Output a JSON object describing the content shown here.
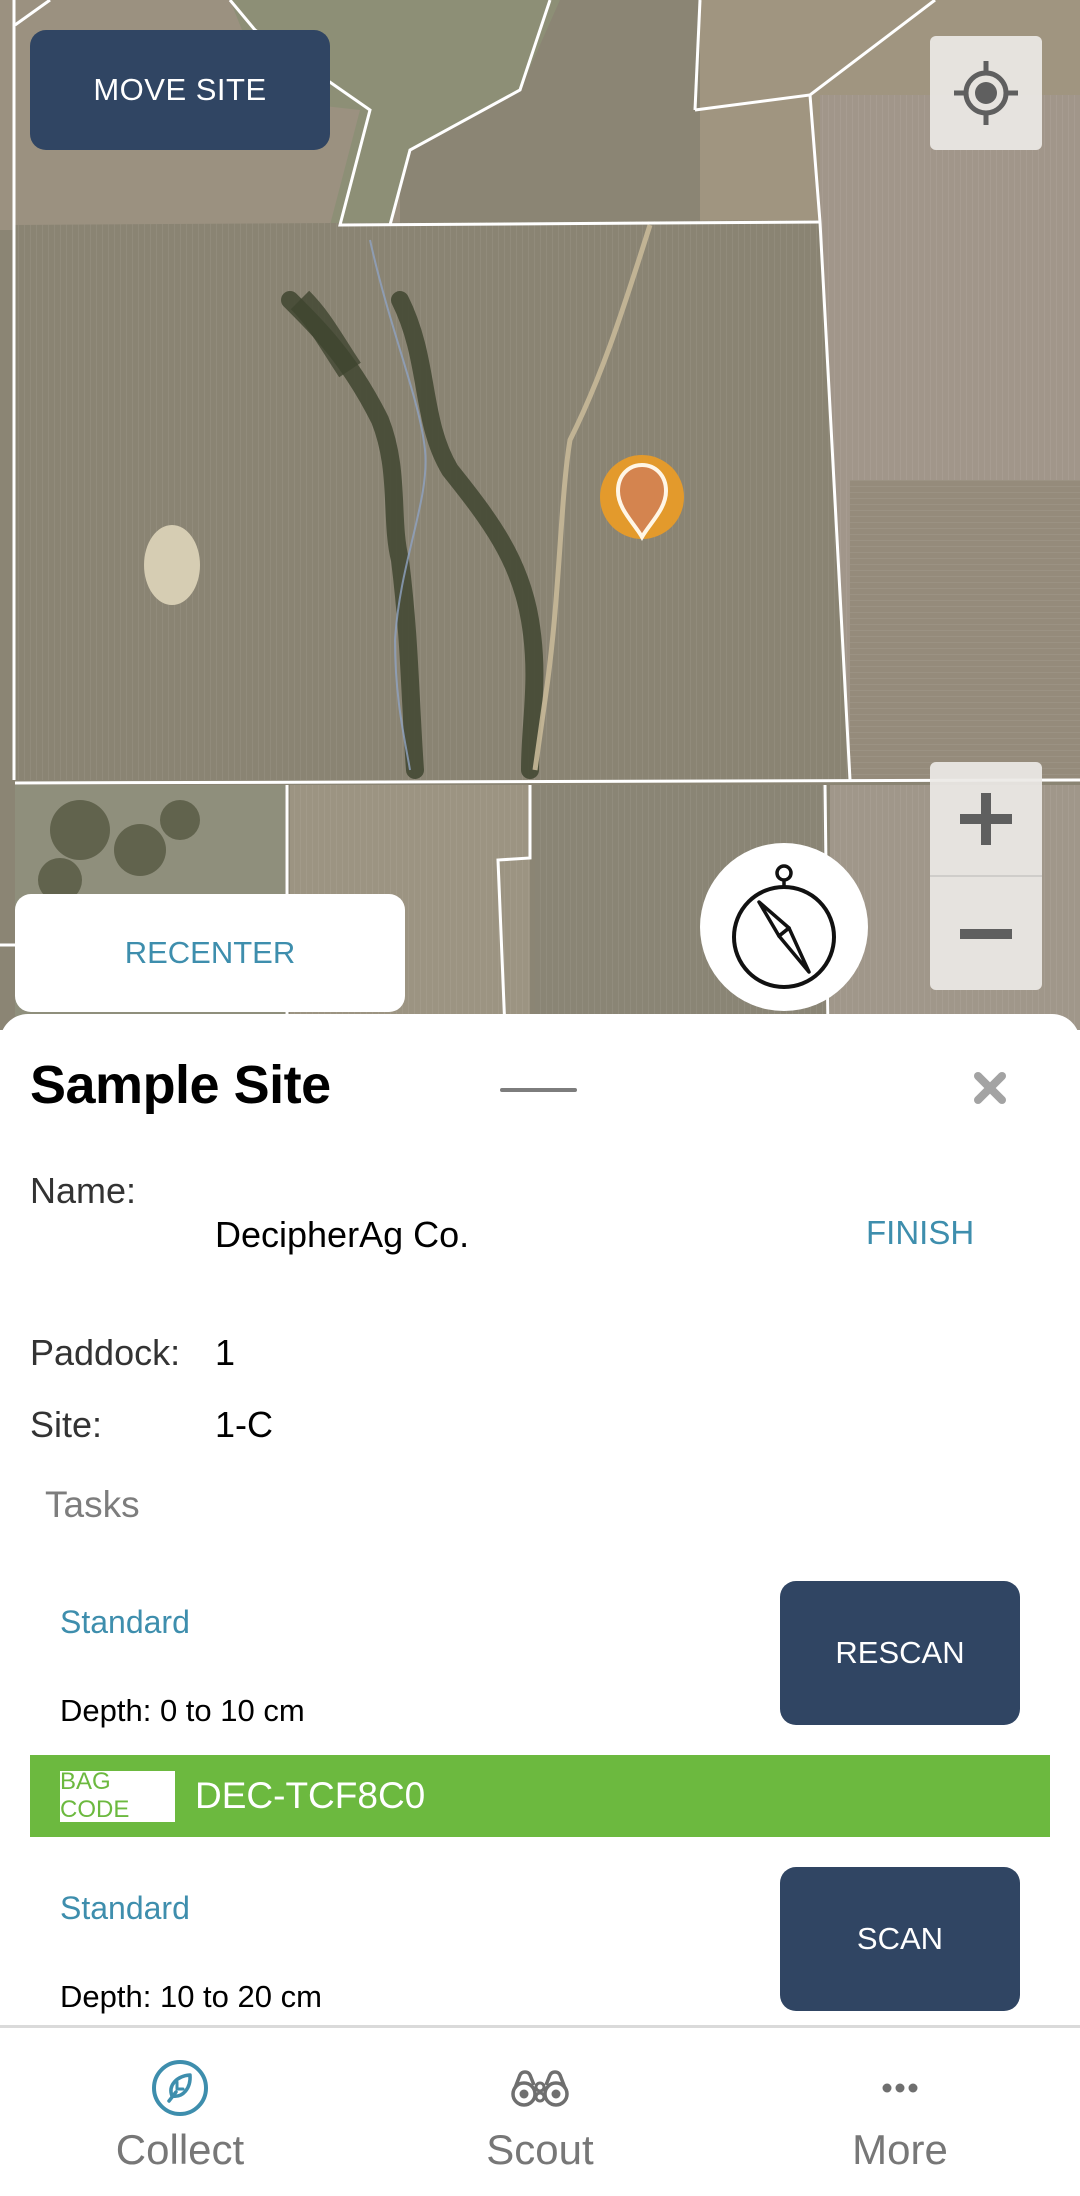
{
  "map": {
    "move_site_label": "MOVE SITE",
    "recenter_label": "RECENTER",
    "controls": {
      "locate_icon": "my-location-icon",
      "zoom_in_icon": "plus-icon",
      "zoom_out_icon": "minus-icon",
      "compass_icon": "compass-icon"
    },
    "marker": {
      "icon": "map-pin-icon",
      "color": "#d4844f",
      "ring_color": "#e39a2c"
    }
  },
  "sheet": {
    "title": "Sample Site",
    "close_icon": "close-icon",
    "name_label": "Name:",
    "name_value": "DecipherAg Co.",
    "finish_label": "FINISH",
    "paddock_label": "Paddock:",
    "paddock_value": "1",
    "site_label": "Site:",
    "site_value": "1-C",
    "tasks_heading": "Tasks",
    "tasks": [
      {
        "type": "Standard",
        "depth": "Depth: 0 to 10 cm",
        "action": "RESCAN",
        "bag_code_label": "BAG CODE",
        "bag_code": "DEC-TCF8C0"
      },
      {
        "type": "Standard",
        "depth": "Depth: 10 to 20 cm",
        "action": "SCAN"
      }
    ]
  },
  "nav": {
    "items": [
      {
        "label": "Collect",
        "icon": "leaf-icon",
        "active": true
      },
      {
        "label": "Scout",
        "icon": "binoculars-icon",
        "active": false
      },
      {
        "label": "More",
        "icon": "more-icon",
        "active": false
      }
    ]
  },
  "colors": {
    "primary_button": "#304563",
    "accent_link": "#3e8ead",
    "bag_code_bar": "#6cb93f",
    "nav_inactive": "#777777"
  }
}
